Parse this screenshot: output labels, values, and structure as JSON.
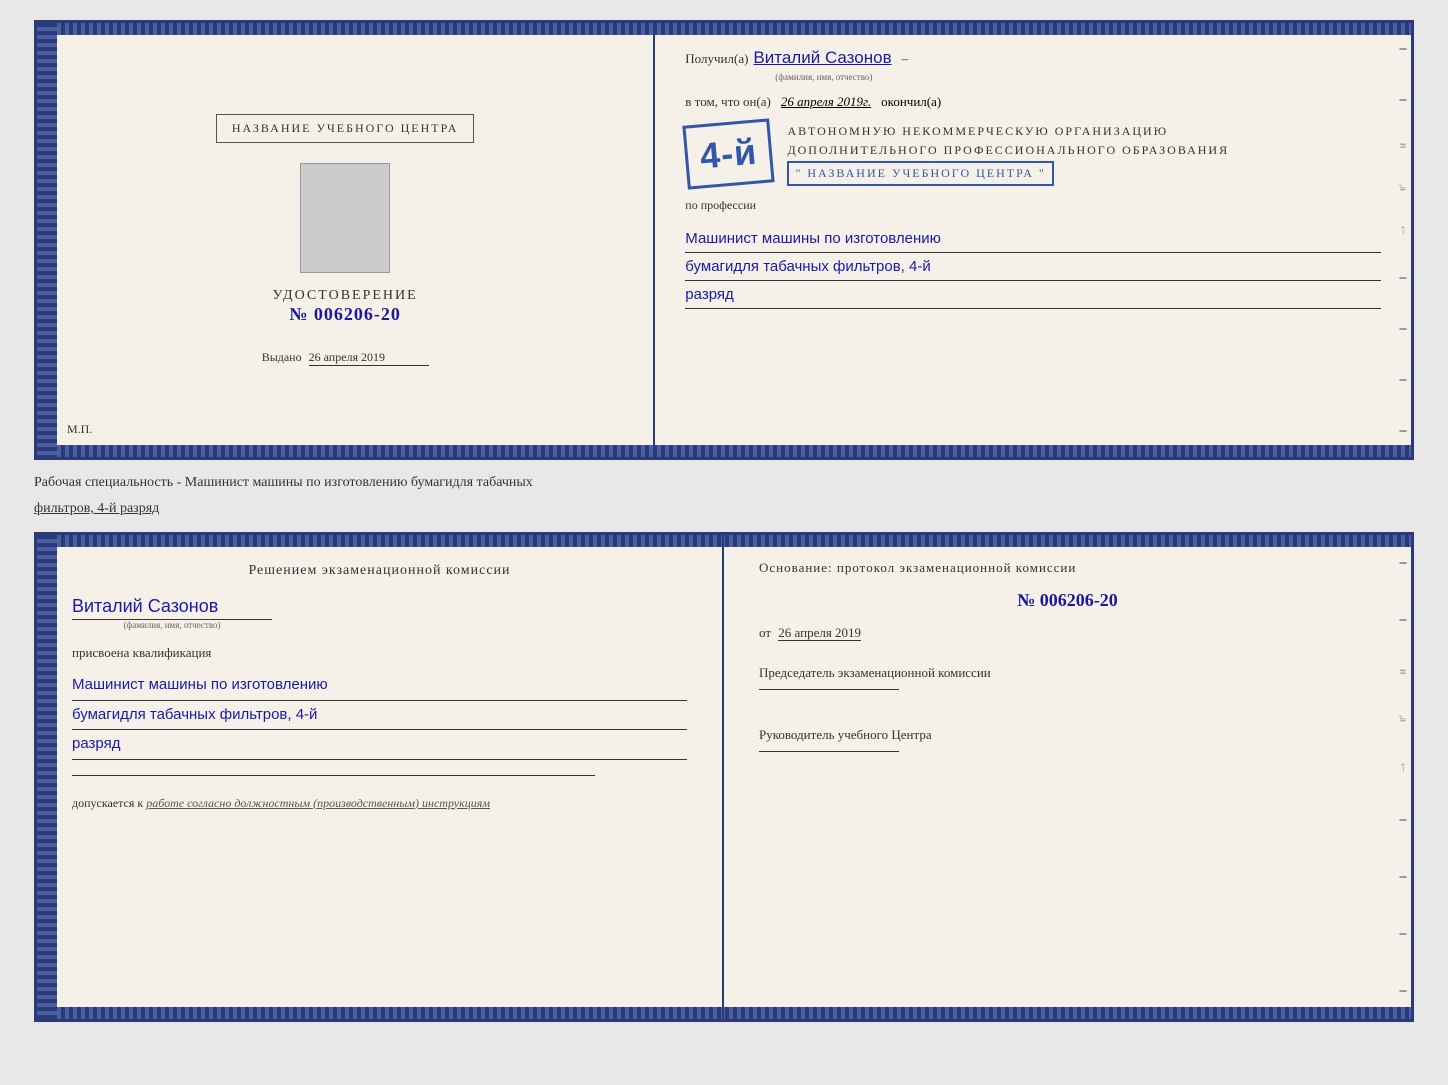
{
  "top_cert": {
    "left": {
      "title_box": "НАЗВАНИЕ УЧЕБНОГО ЦЕНТРА",
      "udostoverenie_label": "УДОСТОВЕРЕНИЕ",
      "number": "№ 006206-20",
      "issued_label": "Выдано",
      "issued_date": "26 апреля 2019",
      "mp_label": "М.П."
    },
    "right": {
      "poluchil_prefix": "Получил(а)",
      "recipient_name": "Виталий Сазонов",
      "recipient_subtitle": "(фамилия, имя, отчество)",
      "dash1": "–",
      "v_tom_chto": "в том, что он(а)",
      "date_filled": "26 апреля 2019г.",
      "okonchil": "окончил(а)",
      "stamp_number": "4-й",
      "org_line1": "АВТОНОМНУЮ НЕКОММЕРЧЕСКУЮ ОРГАНИЗАЦИЮ",
      "org_line2": "ДОПОЛНИТЕЛЬНОГО ПРОФЕССИОНАЛЬНОГО ОБРАЗОВАНИЯ",
      "org_name_box": "\" НАЗВАНИЕ УЧЕБНОГО ЦЕНТРА \"",
      "po_professii": "по профессии",
      "profession_line1": "Машинист машины по изготовлению",
      "profession_line2": "бумагидля табачных фильтров, 4-й",
      "profession_line3": "разряд"
    }
  },
  "info_label": "Рабочая специальность - Машинист машины по изготовлению бумагидля табачных",
  "info_label2": "фильтров, 4-й разряд",
  "bottom_cert": {
    "left": {
      "commission_text": "Решением экзаменационной комиссии",
      "person_name": "Виталий Сазонов",
      "person_subtitle": "(фамилия, имя, отчество)",
      "prisvoena_label": "присвоена квалификация",
      "qual_line1": "Машинист машины по изготовлению",
      "qual_line2": "бумагидля табачных фильтров, 4-й",
      "qual_line3": "разряд",
      "dopuskaetsya_prefix": "допускается к",
      "dopuskaetsya_text": "работе согласно должностным (производственным) инструкциям"
    },
    "right": {
      "osnovaniye_label": "Основание: протокол экзаменационной комиссии",
      "protocol_number": "№ 006206-20",
      "date_prefix": "от",
      "date": "26 апреля 2019",
      "chairman_label": "Председатель экзаменационной комиссии",
      "rukovoditel_label": "Руководитель учебного Центра"
    }
  }
}
